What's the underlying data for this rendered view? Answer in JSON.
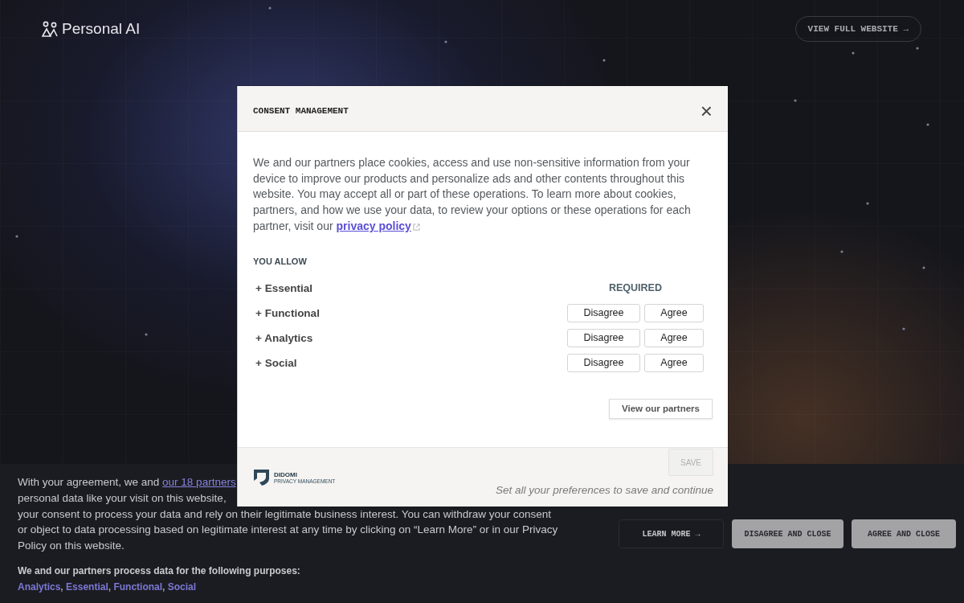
{
  "header": {
    "brand": "Personal AI",
    "action": "VIEW FULL WEBSITE →"
  },
  "banner": {
    "lines": [
      {
        "text": "With your agreement, we and ",
        "link": "our 18 partners"
      },
      {
        "text": "personal data like your visit on this website,"
      },
      {
        "text": "your consent to process your data and rely on their legitimate business interest. You can withdraw your consent"
      },
      {
        "text": "or object to data processing based on legitimate interest at any time by clicking on “Learn More” or in our Privacy"
      },
      {
        "text": "Policy on this website."
      }
    ],
    "purposes_heading": "We and our partners process data for the following purposes:",
    "purposes": [
      {
        "kind": "link",
        "text": "Analytics"
      },
      {
        "kind": "plain",
        "text": ", "
      },
      {
        "kind": "link",
        "text": "Essential"
      },
      {
        "kind": "plain",
        "text": ", "
      },
      {
        "kind": "link",
        "text": "Functional"
      },
      {
        "kind": "plain",
        "text": ", "
      },
      {
        "kind": "link",
        "text": "Social"
      }
    ],
    "buttons": [
      {
        "kind": "outline",
        "label": "LEARN MORE →"
      },
      {
        "kind": "filled",
        "label": "DISAGREE AND CLOSE"
      },
      {
        "kind": "filled",
        "label": "AGREE AND CLOSE"
      }
    ]
  },
  "modal": {
    "title": "CONSENT MANAGEMENT",
    "close": "×",
    "intro": {
      "text": "We and our partners place cookies, access and use non-sensitive information from your device to improve our products and personalize ads and other contents throughout this website. You may accept all or part of these operations. To learn more about cookies, partners, and how we use your data, to review your options or these operations for each partner, visit our ",
      "link": "privacy policy"
    },
    "section_title": "YOU ALLOW",
    "purposes": [
      {
        "kind": "required",
        "label": "+ Essential",
        "status": "REQUIRED"
      },
      {
        "kind": "choice",
        "label": "+ Functional",
        "disagree": "Disagree",
        "agree": "Agree"
      },
      {
        "kind": "choice",
        "label": "+ Analytics",
        "disagree": "Disagree",
        "agree": "Agree"
      },
      {
        "kind": "choice",
        "label": "+ Social",
        "disagree": "Disagree",
        "agree": "Agree"
      }
    ],
    "partners_button": "View our partners",
    "footer": {
      "logo_name": "DIDOMI",
      "logo_tagline": "PRIVACY MANAGEMENT",
      "save": "SAVE",
      "save_disabled": true,
      "hint": "Set all your preferences to save and continue"
    }
  }
}
